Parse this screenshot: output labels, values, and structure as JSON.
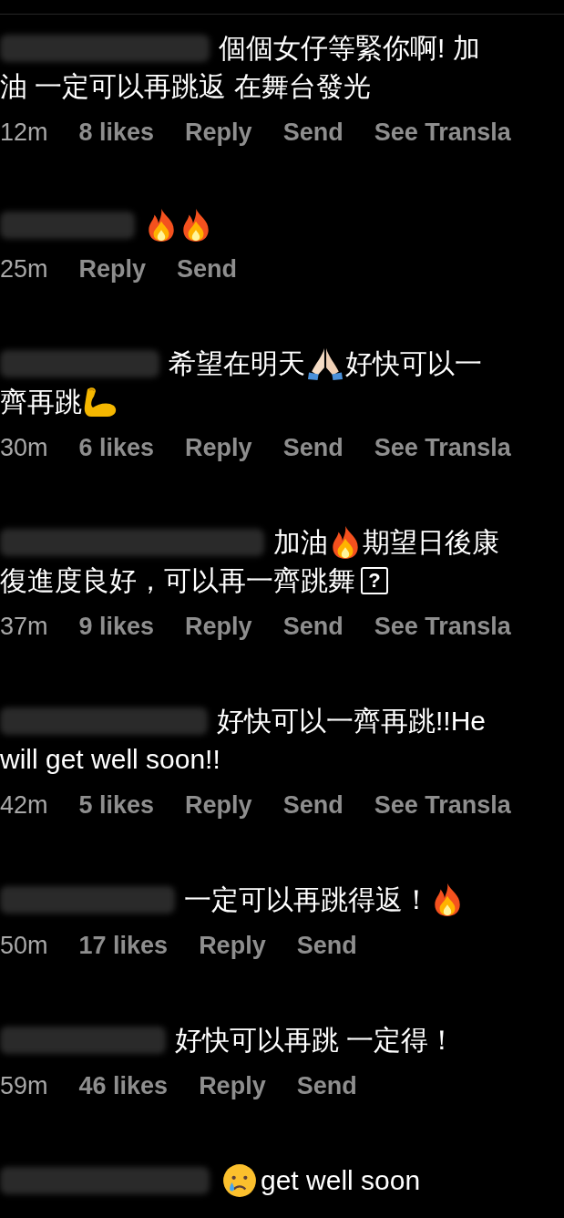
{
  "comments": [
    {
      "lines": [
        [
          {
            "kind": "text",
            "text": "個個女仔等緊你啊! 加"
          }
        ],
        [
          {
            "kind": "text",
            "text": "油 一定可以再跳返 在舞台發光"
          }
        ]
      ],
      "time": "12m",
      "likes": "8 likes",
      "actions": [
        "Reply",
        "Send",
        "See Transla"
      ]
    },
    {
      "lines": [
        [
          {
            "kind": "fire"
          },
          {
            "kind": "fire"
          }
        ]
      ],
      "time": "25m",
      "actions": [
        "Reply",
        "Send"
      ]
    },
    {
      "lines": [
        [
          {
            "kind": "text",
            "text": "希望在明天"
          },
          {
            "kind": "pray"
          },
          {
            "kind": "text",
            "text": "好快可以一"
          }
        ],
        [
          {
            "kind": "text",
            "text": "齊再跳"
          },
          {
            "kind": "muscle"
          }
        ]
      ],
      "time": "30m",
      "likes": "6 likes",
      "actions": [
        "Reply",
        "Send",
        "See Transla"
      ]
    },
    {
      "lines": [
        [
          {
            "kind": "text",
            "text": "加油"
          },
          {
            "kind": "fire"
          },
          {
            "kind": "text",
            "text": "期望日後康"
          }
        ],
        [
          {
            "kind": "text",
            "text": "復進度良好，可以再一齊跳舞"
          },
          {
            "kind": "missing",
            "text": "?"
          }
        ]
      ],
      "time": "37m",
      "likes": "9 likes",
      "actions": [
        "Reply",
        "Send",
        "See Transla"
      ]
    },
    {
      "lines": [
        [
          {
            "kind": "text",
            "text": "好快可以一齊再跳!!He"
          }
        ],
        [
          {
            "kind": "text",
            "text": "will get well soon!!"
          }
        ]
      ],
      "time": "42m",
      "likes": "5 likes",
      "actions": [
        "Reply",
        "Send",
        "See Transla"
      ]
    },
    {
      "lines": [
        [
          {
            "kind": "text",
            "text": "一定可以再跳得返！"
          },
          {
            "kind": "fire"
          }
        ]
      ],
      "time": "50m",
      "likes": "17 likes",
      "actions": [
        "Reply",
        "Send"
      ]
    },
    {
      "lines": [
        [
          {
            "kind": "text",
            "text": "好快可以再跳 一定得！"
          }
        ]
      ],
      "time": "59m",
      "likes": "46 likes",
      "actions": [
        "Reply",
        "Send"
      ]
    },
    {
      "lines": [
        [
          {
            "kind": "cry"
          },
          {
            "kind": "text",
            "text": "get well soon"
          }
        ]
      ]
    }
  ]
}
